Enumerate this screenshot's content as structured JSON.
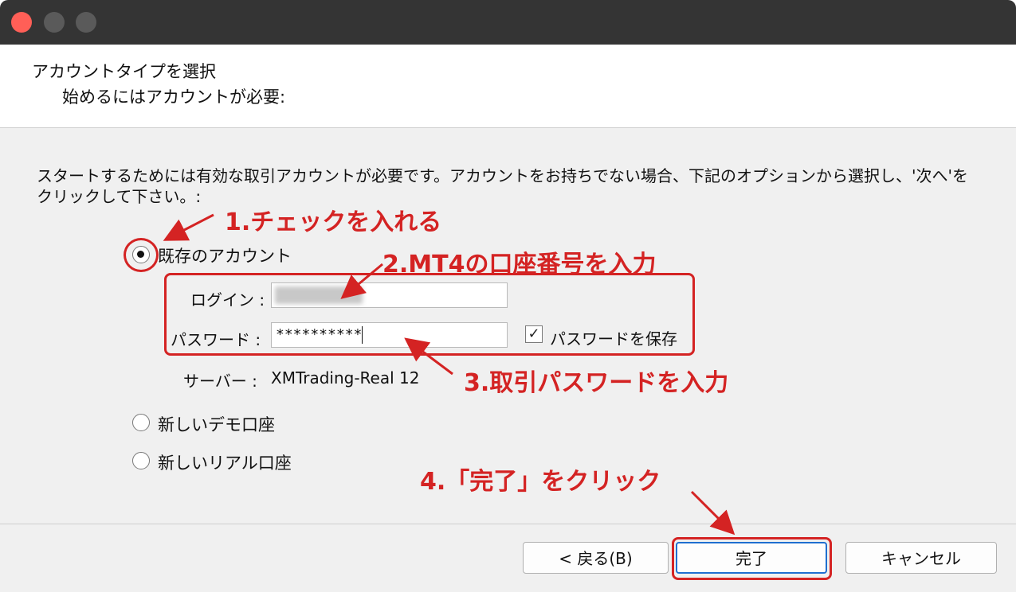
{
  "header": {
    "title": "アカウントタイプを選択",
    "subtitle": "始めるにはアカウントが必要:"
  },
  "description": "スタートするためには有効な取引アカウントが必要です。アカウントをお持ちでない場合、下記のオプションから選択し、'次へ'をクリックして下さい。:",
  "options": {
    "existing": "既存のアカウント",
    "demo": "新しいデモ口座",
    "real": "新しいリアル口座"
  },
  "form": {
    "login_label": "ログイン :",
    "login_value": "",
    "password_label": "パスワード :",
    "password_value": "**********",
    "save_password_label": "パスワードを保存",
    "server_label": "サーバー :",
    "server_value": "XMTrading-Real 12"
  },
  "buttons": {
    "back": "< 戻る(B)",
    "finish": "完了",
    "cancel": "キャンセル"
  },
  "annotations": {
    "step1": "1.チェックを入れる",
    "step2": "2.MT4の口座番号を入力",
    "step3": "3.取引パスワードを入力",
    "step4": "4.「完了」をクリック"
  },
  "colors": {
    "annotation": "#d42323",
    "primary_border": "#1e6fd0"
  }
}
